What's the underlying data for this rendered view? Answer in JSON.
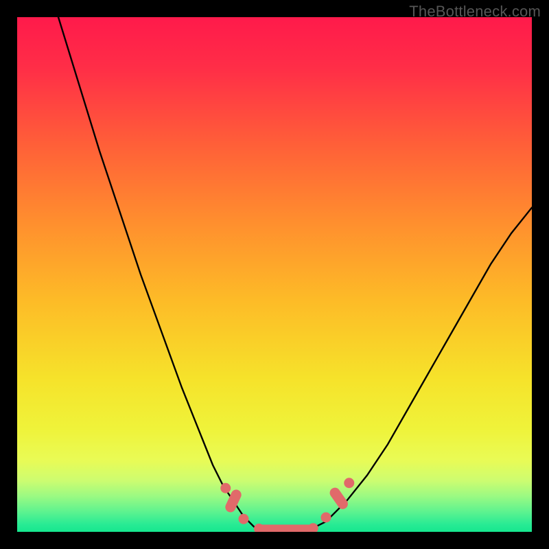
{
  "watermark": "TheBottleneck.com",
  "colors": {
    "frame_bg": "#000000",
    "gradient_stops": [
      {
        "offset": 0.0,
        "color": "#ff1a4b"
      },
      {
        "offset": 0.1,
        "color": "#ff2e47"
      },
      {
        "offset": 0.25,
        "color": "#ff6038"
      },
      {
        "offset": 0.4,
        "color": "#ff8f2e"
      },
      {
        "offset": 0.55,
        "color": "#fdbb27"
      },
      {
        "offset": 0.7,
        "color": "#f6e22a"
      },
      {
        "offset": 0.8,
        "color": "#eff33a"
      },
      {
        "offset": 0.86,
        "color": "#e9fb55"
      },
      {
        "offset": 0.9,
        "color": "#cdfc70"
      },
      {
        "offset": 0.93,
        "color": "#9cfa82"
      },
      {
        "offset": 0.96,
        "color": "#5ff38f"
      },
      {
        "offset": 0.985,
        "color": "#29eb94"
      },
      {
        "offset": 1.0,
        "color": "#16e78f"
      }
    ],
    "curve": "#000000",
    "marker_fill": "#e16a6a",
    "marker_stroke": "#e16a6a"
  },
  "chart_data": {
    "type": "line",
    "title": "",
    "xlabel": "",
    "ylabel": "",
    "xlim": [
      0,
      100
    ],
    "ylim": [
      0,
      100
    ],
    "note": "Axes are normalized percentages; y≈bottleneck %, x≈component balance position. Values estimated from pixels.",
    "series": [
      {
        "name": "left-branch",
        "x": [
          8,
          12,
          16,
          20,
          24,
          28,
          32,
          36,
          38,
          40,
          42,
          44,
          46
        ],
        "y": [
          100,
          87,
          74,
          62,
          50,
          39,
          28,
          18,
          13,
          9,
          6,
          3,
          1
        ]
      },
      {
        "name": "valley",
        "x": [
          46,
          48,
          50,
          52,
          54,
          56,
          58,
          60
        ],
        "y": [
          1,
          0.5,
          0.3,
          0.3,
          0.3,
          0.5,
          1,
          2
        ]
      },
      {
        "name": "right-branch",
        "x": [
          60,
          64,
          68,
          72,
          76,
          80,
          84,
          88,
          92,
          96,
          100
        ],
        "y": [
          2,
          6,
          11,
          17,
          24,
          31,
          38,
          45,
          52,
          58,
          63
        ]
      }
    ],
    "markers": [
      {
        "x": 40.5,
        "y": 8.5,
        "name": "left-upper-dot"
      },
      {
        "x": 42.0,
        "y": 6.0,
        "name": "left-mid-pill",
        "elongated": true,
        "angle": -65
      },
      {
        "x": 44.0,
        "y": 2.5,
        "name": "left-lower-dot"
      },
      {
        "x": 47.0,
        "y": 0.6,
        "name": "valley-left-dot"
      },
      {
        "x": 52.0,
        "y": 0.4,
        "name": "valley-pill",
        "elongated": true,
        "angle": 0,
        "length": 11
      },
      {
        "x": 57.5,
        "y": 0.7,
        "name": "valley-right-dot"
      },
      {
        "x": 60.0,
        "y": 2.8,
        "name": "right-lower-dot"
      },
      {
        "x": 62.5,
        "y": 6.5,
        "name": "right-mid-pill",
        "elongated": true,
        "angle": 55
      },
      {
        "x": 64.5,
        "y": 9.5,
        "name": "right-upper-dot"
      }
    ]
  }
}
